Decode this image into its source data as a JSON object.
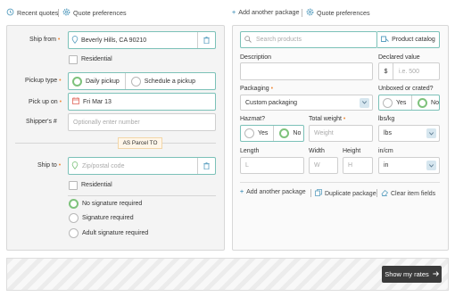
{
  "top_left": {
    "recent_quotes": "Recent quotes",
    "quote_preferences": "Quote preferences"
  },
  "top_right": {
    "add_another_package": "Add another package",
    "quote_preferences": "Quote preferences"
  },
  "left": {
    "ship_from": {
      "label": "Ship from",
      "value": "Beverly Hills, CA 90210"
    },
    "residential_label": "Residential",
    "pickup_type": {
      "label": "Pickup type",
      "daily": "Daily pickup",
      "schedule": "Schedule a pickup"
    },
    "pick_up_on": {
      "label": "Pick up on",
      "value": "Fri Mar 13"
    },
    "shippers_num": {
      "label": "Shipper's #",
      "placeholder": "Optionally enter number"
    },
    "parcel_tag": "AS Parcel TO",
    "ship_to": {
      "label": "Ship to",
      "placeholder": "Zip/postal code"
    },
    "residential2_label": "Residential",
    "signatures": [
      "No signature required",
      "Signature required",
      "Adult signature required"
    ]
  },
  "right": {
    "search_placeholder": "Search products",
    "product_catalog": "Product catalog",
    "description_label": "Description",
    "declared_label": "Declared value",
    "currency_symbol": "$",
    "declared_placeholder": "i.e. 500",
    "packaging_label": "Packaging",
    "packaging_value": "Custom packaging",
    "unboxed_label": "Unboxed or crated?",
    "yes": "Yes",
    "no": "No",
    "hazmat_label": "Hazmat?",
    "total_weight_label": "Total weight",
    "weight_placeholder": "Weight",
    "lbs_kg_label": "lbs/kg",
    "lbs_value": "lbs",
    "length_label": "Length",
    "width_label": "Width",
    "height_label": "Height",
    "in_cm_label": "in/cm",
    "l_placeholder": "L",
    "w_placeholder": "W",
    "h_placeholder": "H",
    "in_value": "in",
    "add_another_package": "Add another package",
    "duplicate_package": "Duplicate package",
    "clear_item_fields": "Clear item fields"
  },
  "footer": {
    "show_rates": "Show my rates"
  },
  "colors": {
    "accent_teal": "#7cc1b8",
    "radio_green": "#7ec27c",
    "required_orange": "#f08c3c",
    "button_dark": "#3b3b3b"
  }
}
